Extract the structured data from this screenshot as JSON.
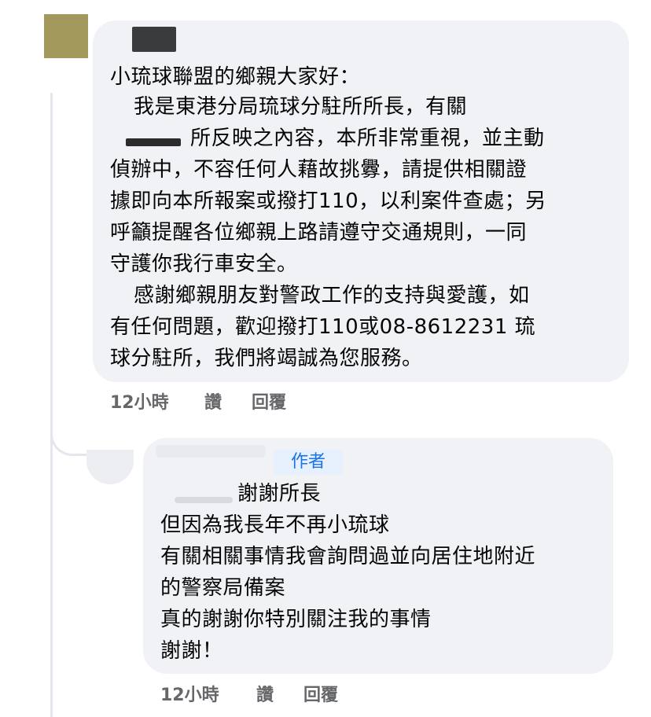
{
  "comment1": {
    "lines": [
      "小琉球聯盟的鄉親大家好：",
      "我是東港分局琉球分駐所所長，有關",
      "所反映之內容，本所非常重視，並主動",
      "偵辦中，不容任何人藉故挑釁，請提供相關證",
      "據即向本所報案或撥打110，以利案件查處；另",
      "呼籲提醒各位鄉親上路請遵守交通規則，一同",
      "守護你我行車安全。",
      "感謝鄉親朋友對警政工作的支持與愛護，如",
      "有任何問題，歡迎撥打110或08-8612231 琉",
      "球分駐所，我們將竭誠為您服務。"
    ],
    "time": "12小時",
    "like": "讚",
    "reply": "回覆"
  },
  "comment2": {
    "badge": "作者",
    "lines": [
      "謝謝所長",
      "但因為我長年不再小琉球",
      "有關相關事情我會詢問過並向居住地附近",
      "的警察局備案",
      "真的謝謝你特別關注我的事情",
      "謝謝！"
    ],
    "time": "12小時",
    "like": "讚",
    "reply": "回覆"
  }
}
